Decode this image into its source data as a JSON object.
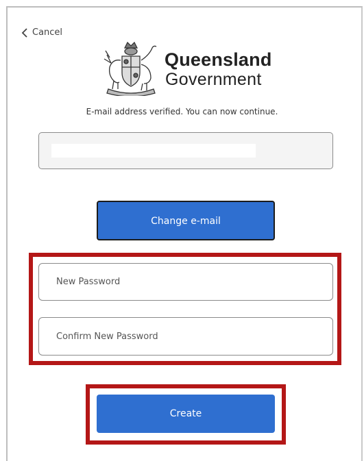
{
  "nav": {
    "cancel_label": "Cancel",
    "cancel_icon": "chevron-left-icon"
  },
  "logo": {
    "line1": "Queensland",
    "line2": "Government",
    "crest_icon": "coat-of-arms-icon"
  },
  "status": {
    "message": "E-mail address verified. You can now continue."
  },
  "email": {
    "value": ""
  },
  "buttons": {
    "change_email": "Change e-mail",
    "create": "Create"
  },
  "fields": {
    "new_password_placeholder": "New Password",
    "confirm_password_placeholder": "Confirm New Password"
  },
  "colors": {
    "primary": "#2f6fd0",
    "highlight": "#b41717"
  }
}
